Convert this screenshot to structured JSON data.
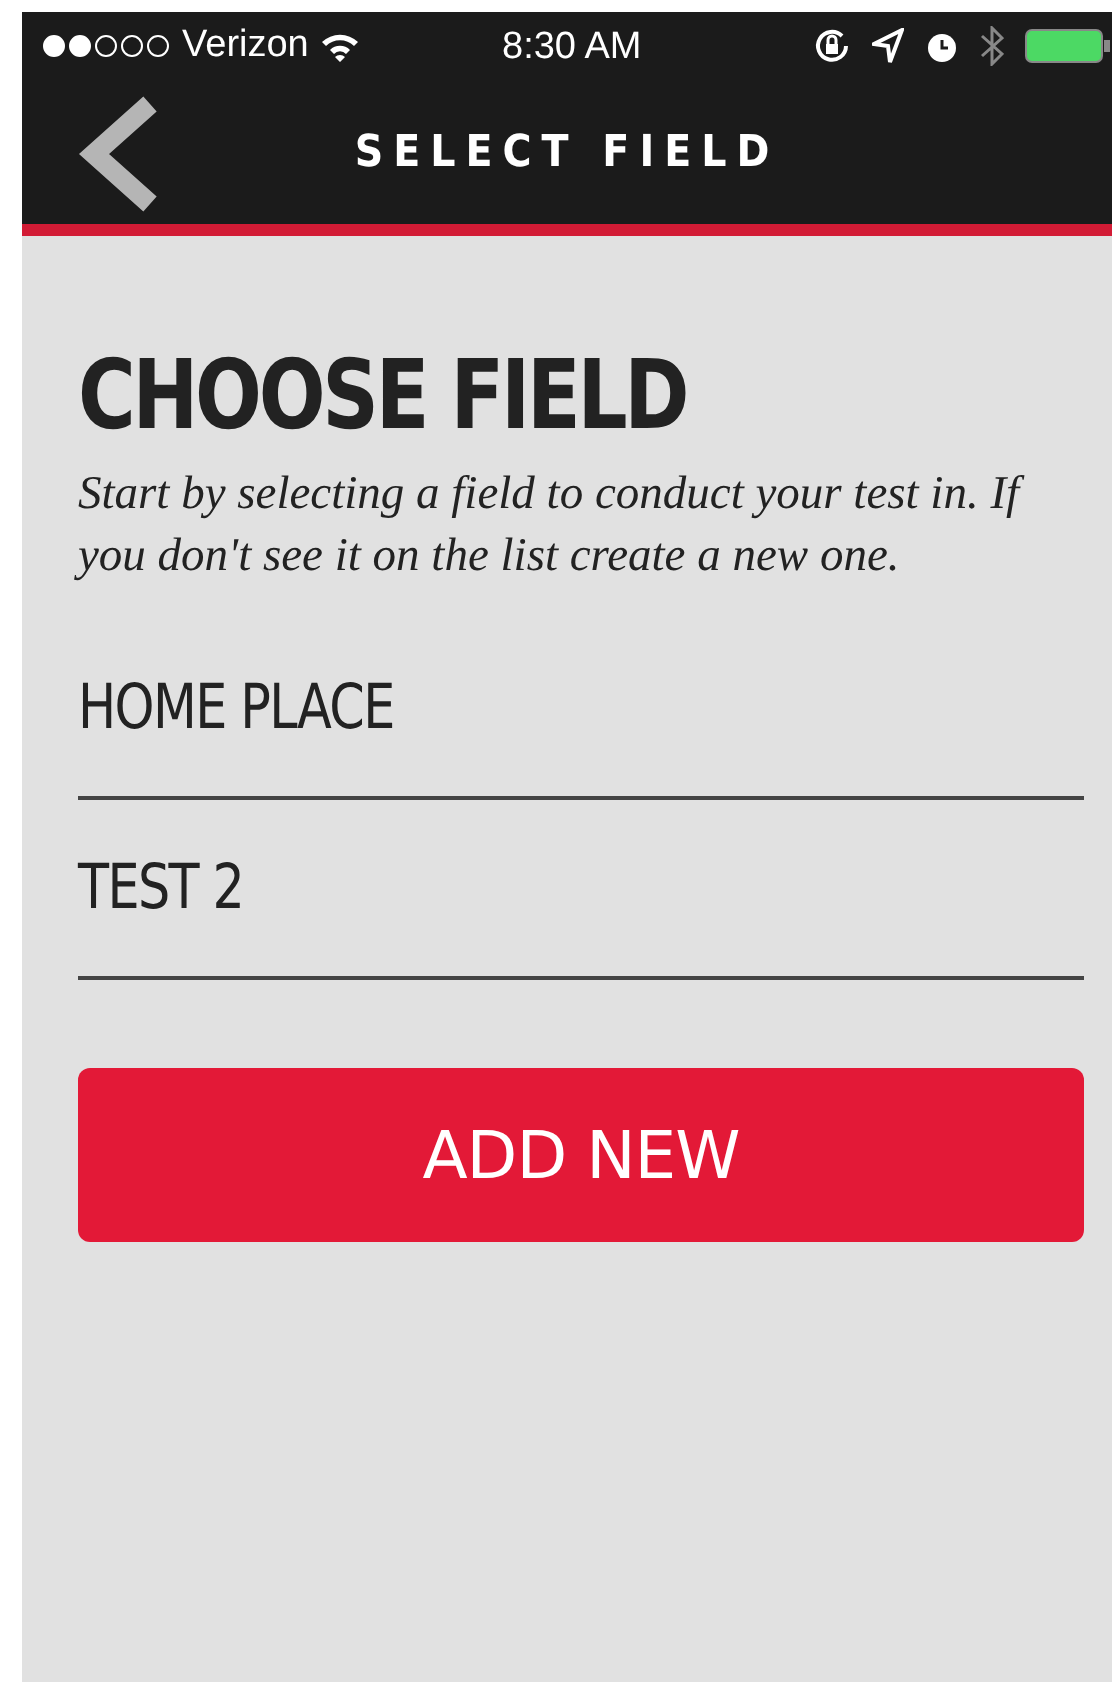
{
  "status_bar": {
    "carrier": "Verizon",
    "time": "8:30 AM"
  },
  "nav_bar": {
    "title": "SELECT FIELD"
  },
  "heading": "CHOOSE FIELD",
  "description": "Start by selecting a field to conduct your test in. If you don't see it on the list create a new one.",
  "fields": [
    {
      "name": "HOME PLACE"
    },
    {
      "name": "TEST 2"
    }
  ],
  "add_button": "ADD NEW"
}
